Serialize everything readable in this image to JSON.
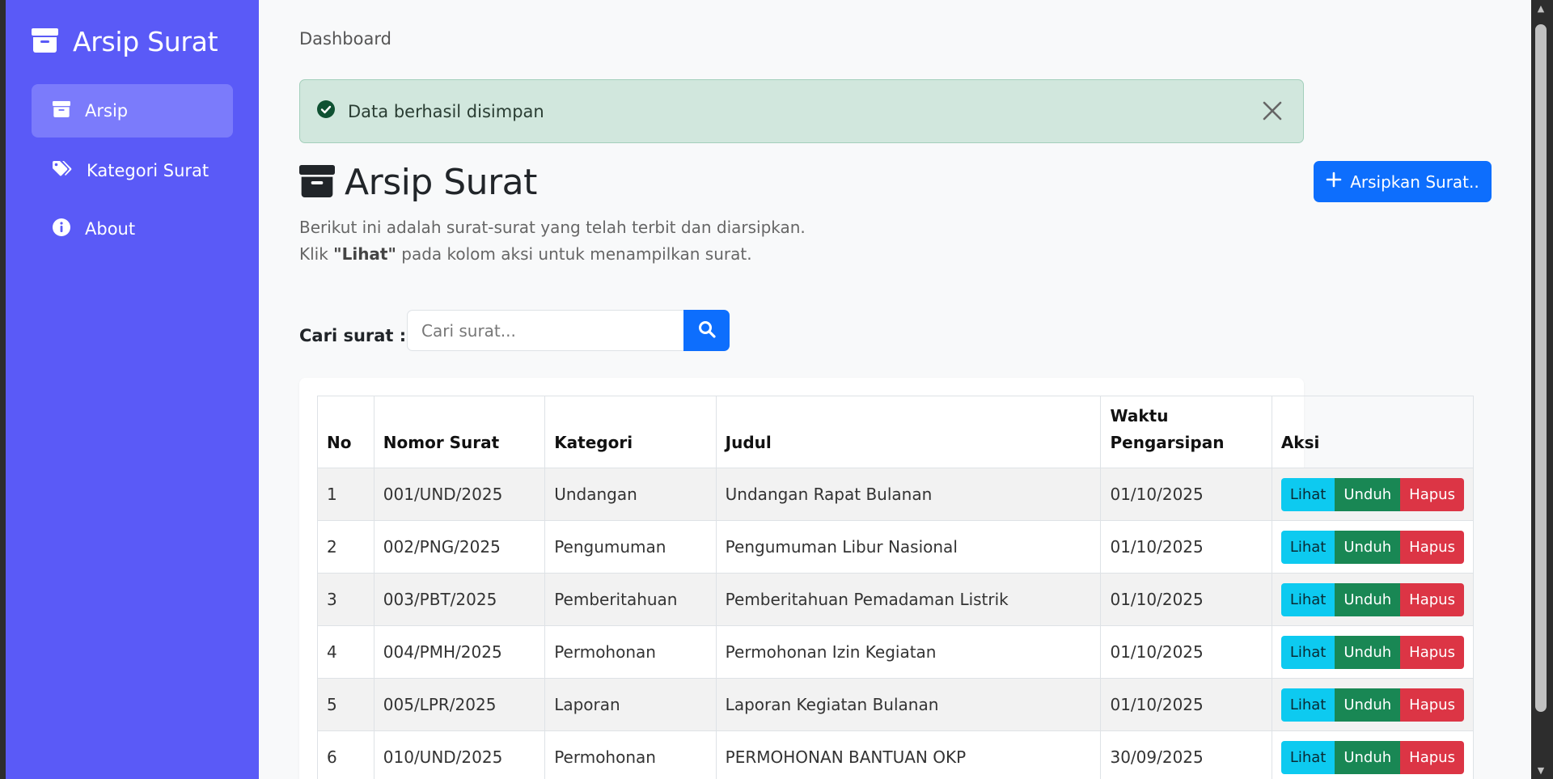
{
  "sidebar": {
    "brand": "Arsip Surat",
    "items": [
      {
        "label": "Arsip",
        "icon": "archive-icon",
        "active": true
      },
      {
        "label": "Kategori Surat",
        "icon": "tags-icon",
        "active": false
      },
      {
        "label": "About",
        "icon": "info-icon",
        "active": false
      }
    ]
  },
  "breadcrumb": "Dashboard",
  "alert": {
    "message": "Data berhasil disimpan",
    "type": "success"
  },
  "page": {
    "title": "Arsip Surat",
    "add_button": "Arsipkan Surat..",
    "desc_line1": "Berikut ini adalah surat-surat yang telah terbit dan diarsipkan.",
    "desc_line2_pre": "Klik ",
    "desc_line2_bold": "\"Lihat\"",
    "desc_line2_post": " pada kolom aksi untuk menampilkan surat."
  },
  "search": {
    "label": "Cari surat :",
    "placeholder": "Cari surat..."
  },
  "table": {
    "headers": {
      "no": "No",
      "nomor": "Nomor Surat",
      "kategori": "Kategori",
      "judul": "Judul",
      "waktu": "Waktu Pengarsipan",
      "aksi": "Aksi"
    },
    "rows": [
      {
        "no": "1",
        "nomor": "001/UND/2025",
        "kategori": "Undangan",
        "judul": "Undangan Rapat Bulanan",
        "waktu": "01/10/2025"
      },
      {
        "no": "2",
        "nomor": "002/PNG/2025",
        "kategori": "Pengumuman",
        "judul": "Pengumuman Libur Nasional",
        "waktu": "01/10/2025"
      },
      {
        "no": "3",
        "nomor": "003/PBT/2025",
        "kategori": "Pemberitahuan",
        "judul": "Pemberitahuan Pemadaman Listrik",
        "waktu": "01/10/2025"
      },
      {
        "no": "4",
        "nomor": "004/PMH/2025",
        "kategori": "Permohonan",
        "judul": "Permohonan Izin Kegiatan",
        "waktu": "01/10/2025"
      },
      {
        "no": "5",
        "nomor": "005/LPR/2025",
        "kategori": "Laporan",
        "judul": "Laporan Kegiatan Bulanan",
        "waktu": "01/10/2025"
      },
      {
        "no": "6",
        "nomor": "010/UND/2025",
        "kategori": "Permohonan",
        "judul": "PERMOHONAN BANTUAN OKP",
        "waktu": "30/09/2025"
      }
    ],
    "actions": {
      "lihat": "Lihat",
      "unduh": "Unduh",
      "hapus": "Hapus"
    }
  },
  "colors": {
    "sidebar": "#5a5af7",
    "sidebar_active": "#7b7bfb",
    "primary": "#0d6efd",
    "info": "#0dcaf0",
    "success": "#198754",
    "danger": "#dc3545",
    "alert_bg": "#d1e7dd"
  }
}
